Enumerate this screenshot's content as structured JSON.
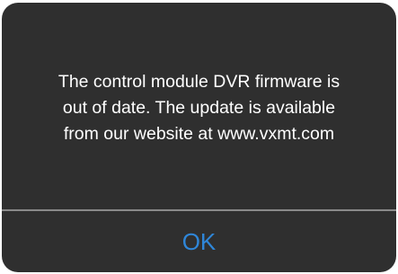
{
  "dialog": {
    "message_lines": [
      "The control module DVR firmware is",
      "out of date. The update is available",
      "from our website at www.vxmt.com"
    ],
    "ok_label": "OK"
  },
  "colors": {
    "dialog_background": "#2f2f2f",
    "message_text": "#ffffff",
    "divider": "#8a8a8a",
    "button_text": "#2f86d8"
  }
}
